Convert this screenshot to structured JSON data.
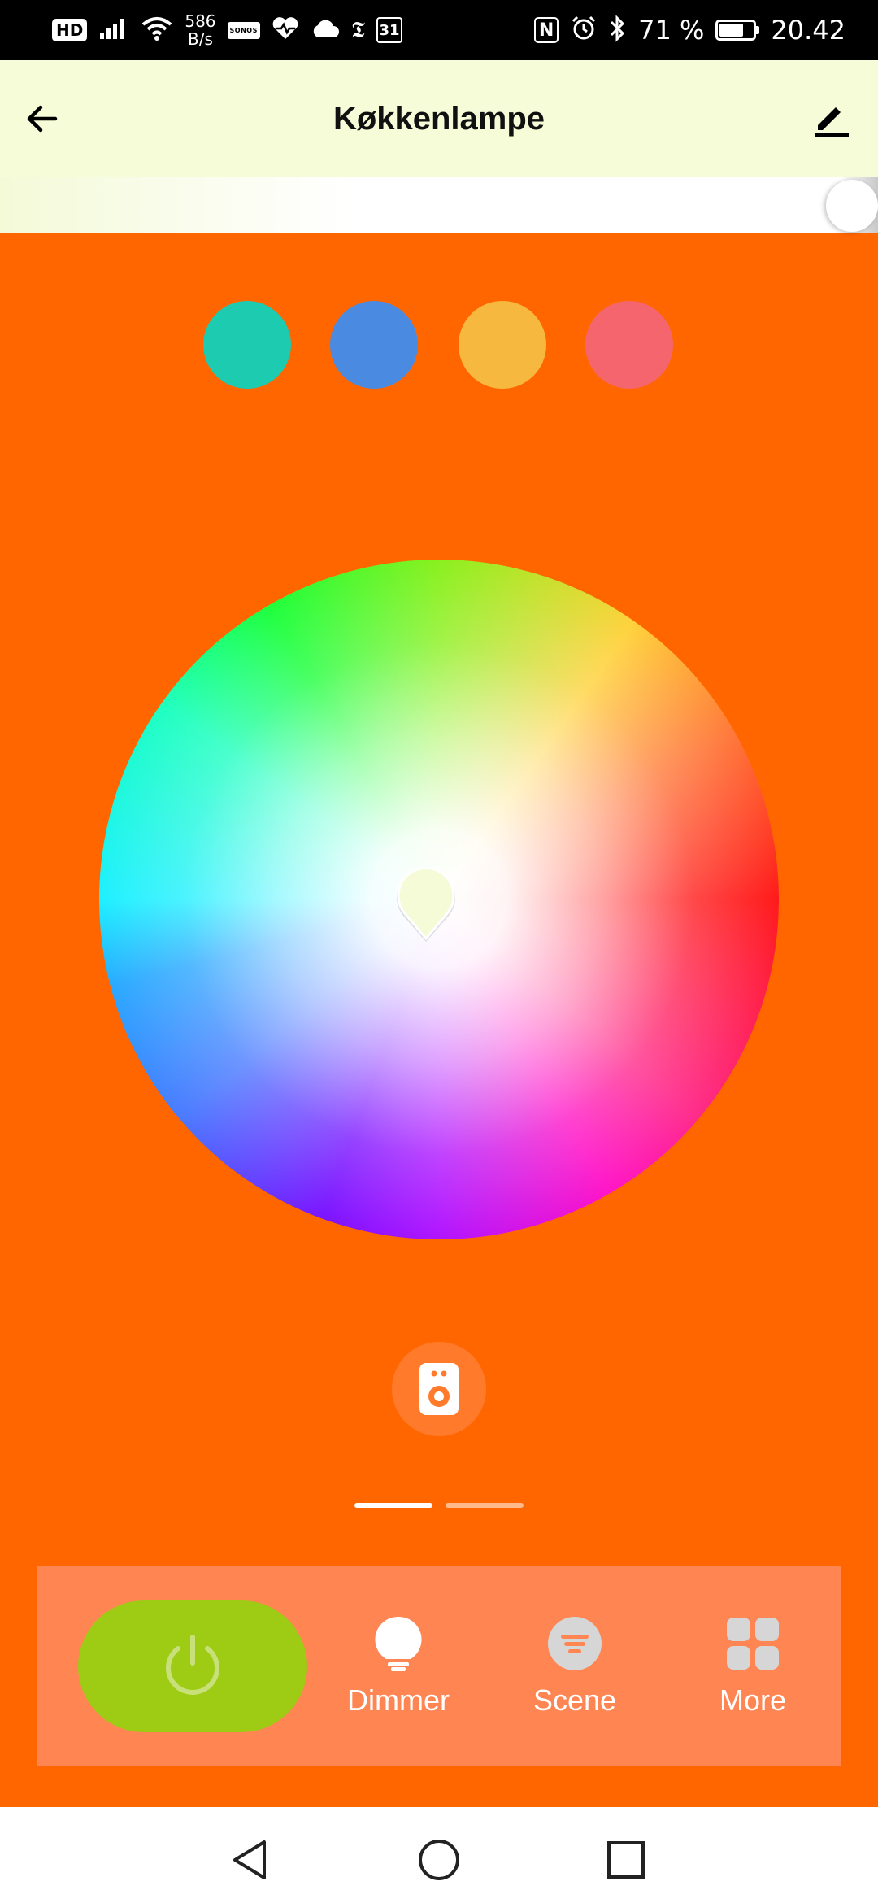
{
  "status_bar": {
    "hd": "HD",
    "net_speed_value": "586",
    "net_speed_unit": "B/s",
    "sonos": "SONOS",
    "nyt": "𝕿",
    "calendar_day": "31",
    "nfc": "N",
    "battery_percent_text": "71 %",
    "battery_level": 0.71,
    "time": "20.42"
  },
  "app_bar": {
    "title": "Køkkenlampe"
  },
  "brightness": {
    "level": 1.0
  },
  "colors": {
    "background": "#ff6600",
    "header": "#f6fcd8",
    "power_on": "#9ecb14",
    "panel": "#ff8552",
    "picker_pin": "#f4fbd6"
  },
  "presets": [
    {
      "color": "#1dcbb0"
    },
    {
      "color": "#4a8ae0"
    },
    {
      "color": "#f7b840"
    },
    {
      "color": "#f5656e"
    }
  ],
  "bottom_tabs": {
    "power_icon": "power-icon",
    "dimmer_label": "Dimmer",
    "scene_label": "Scene",
    "more_label": "More"
  },
  "page_indicator": {
    "pages": 2,
    "active": 0
  }
}
